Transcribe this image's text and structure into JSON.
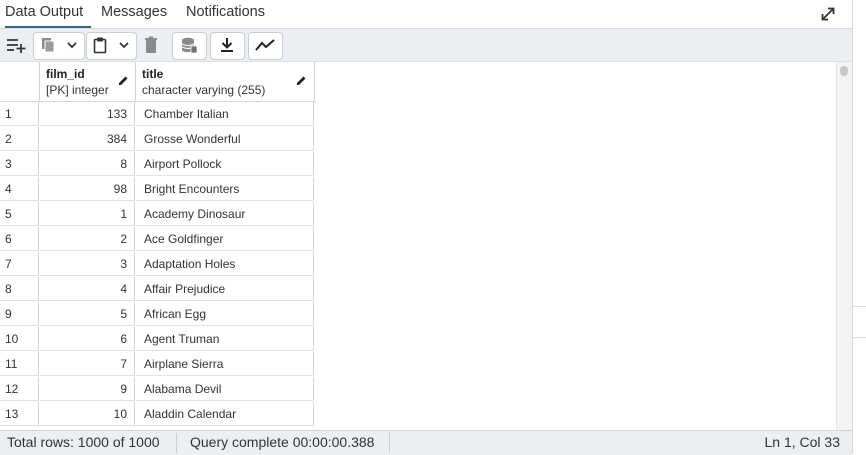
{
  "tabs": [
    {
      "label": "Data Output",
      "active": true
    },
    {
      "label": "Messages",
      "active": false
    },
    {
      "label": "Notifications",
      "active": false
    }
  ],
  "toolbar": {
    "icons": [
      "add-row-icon",
      "copy-icon",
      "chevron-down-icon",
      "paste-icon",
      "chevron-down-icon",
      "delete-icon",
      "save-data-icon",
      "download-icon",
      "graph-visualiser-icon"
    ]
  },
  "grid": {
    "columns": [
      {
        "name": "film_id",
        "type": "[PK] integer"
      },
      {
        "name": "title",
        "type": "character varying (255)"
      }
    ],
    "rows": [
      {
        "n": "1",
        "id": "133",
        "title": "Chamber Italian"
      },
      {
        "n": "2",
        "id": "384",
        "title": "Grosse Wonderful"
      },
      {
        "n": "3",
        "id": "8",
        "title": "Airport Pollock"
      },
      {
        "n": "4",
        "id": "98",
        "title": "Bright Encounters"
      },
      {
        "n": "5",
        "id": "1",
        "title": "Academy Dinosaur"
      },
      {
        "n": "6",
        "id": "2",
        "title": "Ace Goldfinger"
      },
      {
        "n": "7",
        "id": "3",
        "title": "Adaptation Holes"
      },
      {
        "n": "8",
        "id": "4",
        "title": "Affair Prejudice"
      },
      {
        "n": "9",
        "id": "5",
        "title": "African Egg"
      },
      {
        "n": "10",
        "id": "6",
        "title": "Agent Truman"
      },
      {
        "n": "11",
        "id": "7",
        "title": "Airplane Sierra"
      },
      {
        "n": "12",
        "id": "9",
        "title": "Alabama Devil"
      },
      {
        "n": "13",
        "id": "10",
        "title": "Aladdin Calendar"
      }
    ]
  },
  "status": {
    "total": "Total rows: 1000 of 1000",
    "query": "Query complete 00:00:00.388",
    "position": "Ln 1, Col 33"
  },
  "colors": {
    "accent": "#326690",
    "toolbar_bg": "#ebeef3"
  }
}
